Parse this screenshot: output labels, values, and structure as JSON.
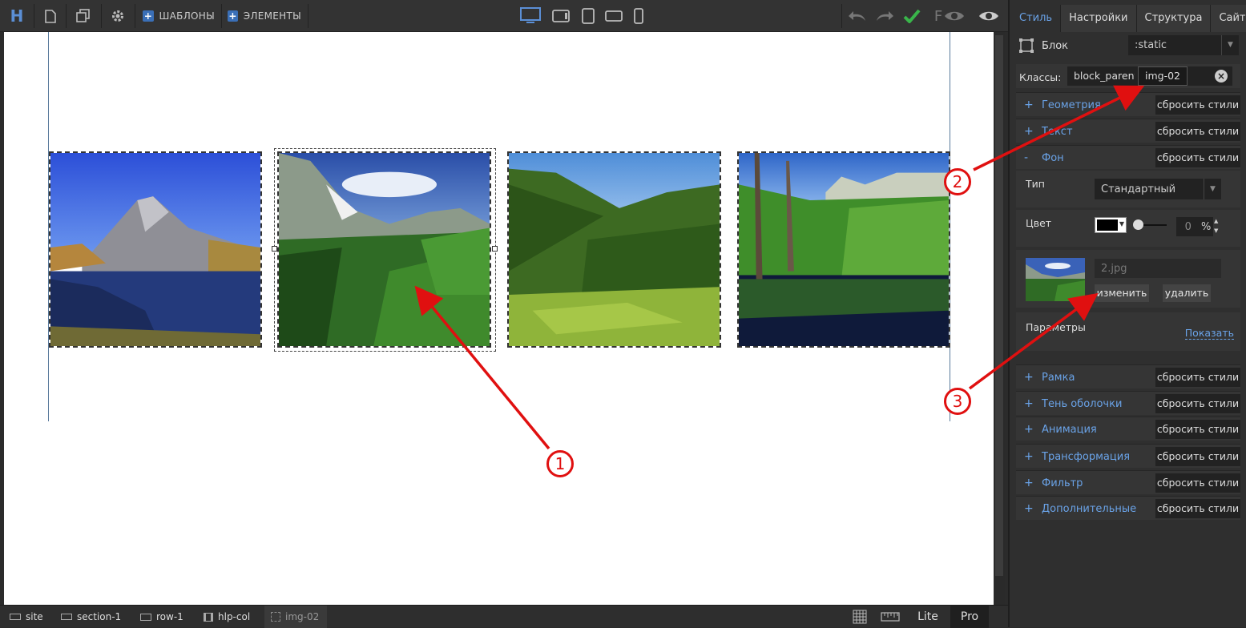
{
  "toolbar": {
    "logo": "H",
    "templates_label": "ШАБЛОНЫ",
    "elements_label": "ЭЛЕМЕНТЫ",
    "preview_f": "F"
  },
  "canvas": {
    "images": [
      {
        "name": "mountain-lake",
        "scene": "mountain"
      },
      {
        "name": "alpine-valley",
        "scene": "alpine"
      },
      {
        "name": "green-hills",
        "scene": "hills"
      },
      {
        "name": "forest-lake",
        "scene": "lake"
      }
    ]
  },
  "callouts": [
    "1",
    "2",
    "3"
  ],
  "breadcrumb": [
    {
      "label": "site",
      "icon": "rect-icon"
    },
    {
      "label": "section-1",
      "icon": "section-icon"
    },
    {
      "label": "row-1",
      "icon": "rows-icon"
    },
    {
      "label": "hlp-col",
      "icon": "cols-icon"
    },
    {
      "label": "img-02",
      "icon": "frame-icon"
    }
  ],
  "footer": {
    "lite": "Lite",
    "pro": "Pro"
  },
  "panel": {
    "tabs": [
      "Стиль",
      "Настройки",
      "Структура",
      "Сайт"
    ],
    "block_label": "Блок",
    "state_value": ":static",
    "classes_label": "Классы:",
    "class_1": "block_parent",
    "class_2": "img-02",
    "reset_label": "сбросить стили",
    "sections_top": [
      {
        "sign": "+",
        "label": "Геометрия"
      },
      {
        "sign": "+",
        "label": "Текст"
      },
      {
        "sign": "-",
        "label": "Фон"
      }
    ],
    "bg": {
      "type_label": "Тип",
      "type_value": "Стандартный",
      "color_label": "Цвет",
      "color_value": "#000000",
      "opacity_value": "0",
      "opacity_unit": "%",
      "file_name": "2.jpg",
      "change_label": "изменить",
      "delete_label": "удалить",
      "params_label": "Параметры",
      "show_label": "Показать"
    },
    "sections_bottom": [
      {
        "sign": "+",
        "label": "Рамка"
      },
      {
        "sign": "+",
        "label": "Тень оболочки"
      },
      {
        "sign": "+",
        "label": "Анимация"
      },
      {
        "sign": "+",
        "label": "Трансформация"
      },
      {
        "sign": "+",
        "label": "Фильтр"
      },
      {
        "sign": "+",
        "label": "Дополнительные"
      }
    ]
  }
}
